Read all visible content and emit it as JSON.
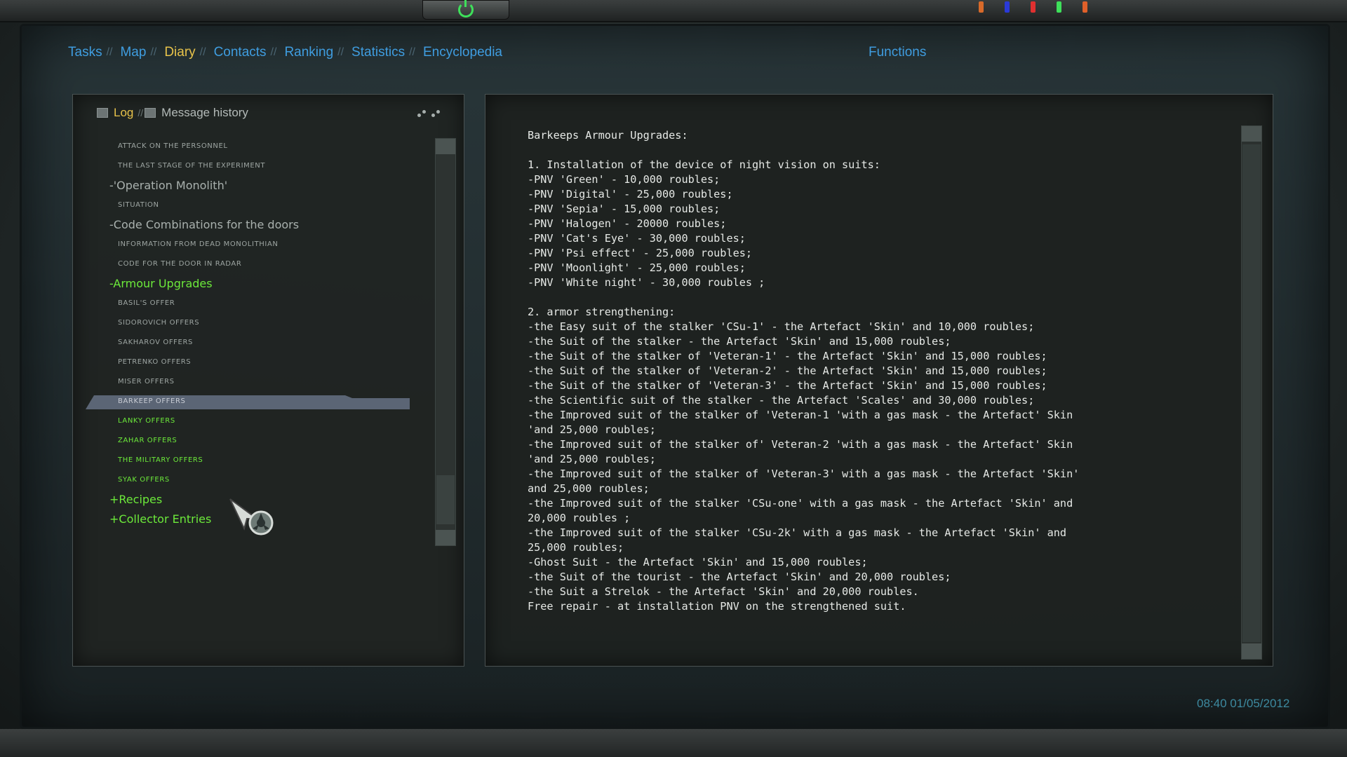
{
  "nav": {
    "items": [
      {
        "label": "Tasks"
      },
      {
        "label": "Map"
      },
      {
        "label": "Diary",
        "active": true
      },
      {
        "label": "Contacts"
      },
      {
        "label": "Ranking"
      },
      {
        "label": "Statistics"
      },
      {
        "label": "Encyclopedia"
      }
    ],
    "separator": "//",
    "functions_label": "Functions"
  },
  "left_panel": {
    "tabs": [
      {
        "label": "Log",
        "active": true
      },
      {
        "label": "Message history",
        "active": false
      }
    ],
    "tab_separator": "//",
    "tree": [
      {
        "label": "ATTACK ON THE PERSONNEL",
        "kind": "sub"
      },
      {
        "label": "THE LAST STAGE OF THE EXPERIMENT",
        "kind": "sub"
      },
      {
        "label": "-'Operation Monolith'",
        "kind": "group"
      },
      {
        "label": "SITUATION",
        "kind": "sub"
      },
      {
        "label": "-Code Combinations for the doors",
        "kind": "group"
      },
      {
        "label": "INFORMATION FROM DEAD MONOLITHIAN",
        "kind": "sub"
      },
      {
        "label": "CODE FOR THE DOOR IN RADAR",
        "kind": "sub"
      },
      {
        "label": "-Armour Upgrades",
        "kind": "group",
        "color": "green"
      },
      {
        "label": "BASIL'S OFFER",
        "kind": "sub"
      },
      {
        "label": "SIDOROVICH OFFERS",
        "kind": "sub"
      },
      {
        "label": "SAKHAROV OFFERS",
        "kind": "sub"
      },
      {
        "label": "PETRENKO OFFERS",
        "kind": "sub"
      },
      {
        "label": "MISER OFFERS",
        "kind": "sub"
      },
      {
        "label": "BARKEEP OFFERS",
        "kind": "sub",
        "selected": true
      },
      {
        "label": "LANKY OFFERS",
        "kind": "sub",
        "color": "green"
      },
      {
        "label": "ZAHAR OFFERS",
        "kind": "sub",
        "color": "green"
      },
      {
        "label": "THE MILITARY OFFERS",
        "kind": "sub",
        "color": "green"
      },
      {
        "label": "SYAK OFFERS",
        "kind": "sub",
        "color": "green"
      },
      {
        "label": "+Recipes",
        "kind": "group",
        "color": "green"
      },
      {
        "label": "+Collector Entries",
        "kind": "group",
        "color": "green"
      }
    ]
  },
  "document": {
    "lines": [
      "Barkeeps Armour Upgrades:",
      "",
      "1. Installation of the device of night vision on suits:",
      "-PNV 'Green' - 10,000 roubles;",
      "-PNV 'Digital' - 25,000 roubles;",
      "-PNV 'Sepia' - 15,000 roubles;",
      "-PNV 'Halogen' - 20000 roubles;",
      "-PNV 'Cat's Eye' - 30,000 roubles;",
      "-PNV 'Psi effect' - 25,000 roubles;",
      "-PNV 'Moonlight' - 25,000 roubles;",
      "-PNV 'White night' - 30,000 roubles ;",
      "",
      "2. armor strengthening:",
      "-the Easy suit of the stalker 'CSu-1' - the Artefact 'Skin' and 10,000 roubles;",
      "-the Suit of the stalker - the Artefact 'Skin' and 15,000 roubles;",
      "-the Suit of the stalker of 'Veteran-1' - the Artefact 'Skin' and 15,000 roubles;",
      "-the Suit of the stalker of 'Veteran-2' - the Artefact 'Skin' and 15,000 roubles;",
      "-the Suit of the stalker of 'Veteran-3' - the Artefact 'Skin' and 15,000 roubles;",
      "-the Scientific suit of the stalker - the Artefact 'Scales' and 30,000 roubles;",
      "-the Improved suit of the stalker of 'Veteran-1 'with a gas mask - the Artefact' Skin",
      "'and 25,000 roubles;",
      "-the Improved suit of the stalker of' Veteran-2 'with a gas mask - the Artefact' Skin",
      "'and 25,000 roubles;",
      "-the Improved suit of the stalker of 'Veteran-3' with a gas mask - the Artefact 'Skin'",
      "and 25,000 roubles;",
      "-the Improved suit of the stalker 'CSu-one' with a gas mask - the Artefact 'Skin' and",
      "20,000 roubles ;",
      "-the Improved suit of the stalker 'CSu-2k' with a gas mask - the Artefact 'Skin' and",
      "25,000 roubles;",
      "-Ghost Suit - the Artefact 'Skin' and 15,000 roubles;",
      "-the Suit of the tourist - the Artefact 'Skin' and 20,000 roubles;",
      "-the Suit a Strelok - the Artefact 'Skin' and 20,000 roubles.",
      "Free repair - at installation PNV on the strengthened suit."
    ]
  },
  "status": {
    "timestamp": "08:40 01/05/2012"
  },
  "colors": {
    "nav_link": "#3f9de0",
    "nav_active": "#e7c24a",
    "green_entry": "#6cea3a",
    "selected_bar": "#5b6575",
    "timestamp": "#3d8aa0"
  },
  "icons": {
    "power": "power-icon",
    "tab": "folder-icon",
    "cursor": "stalker-cursor-icon"
  }
}
